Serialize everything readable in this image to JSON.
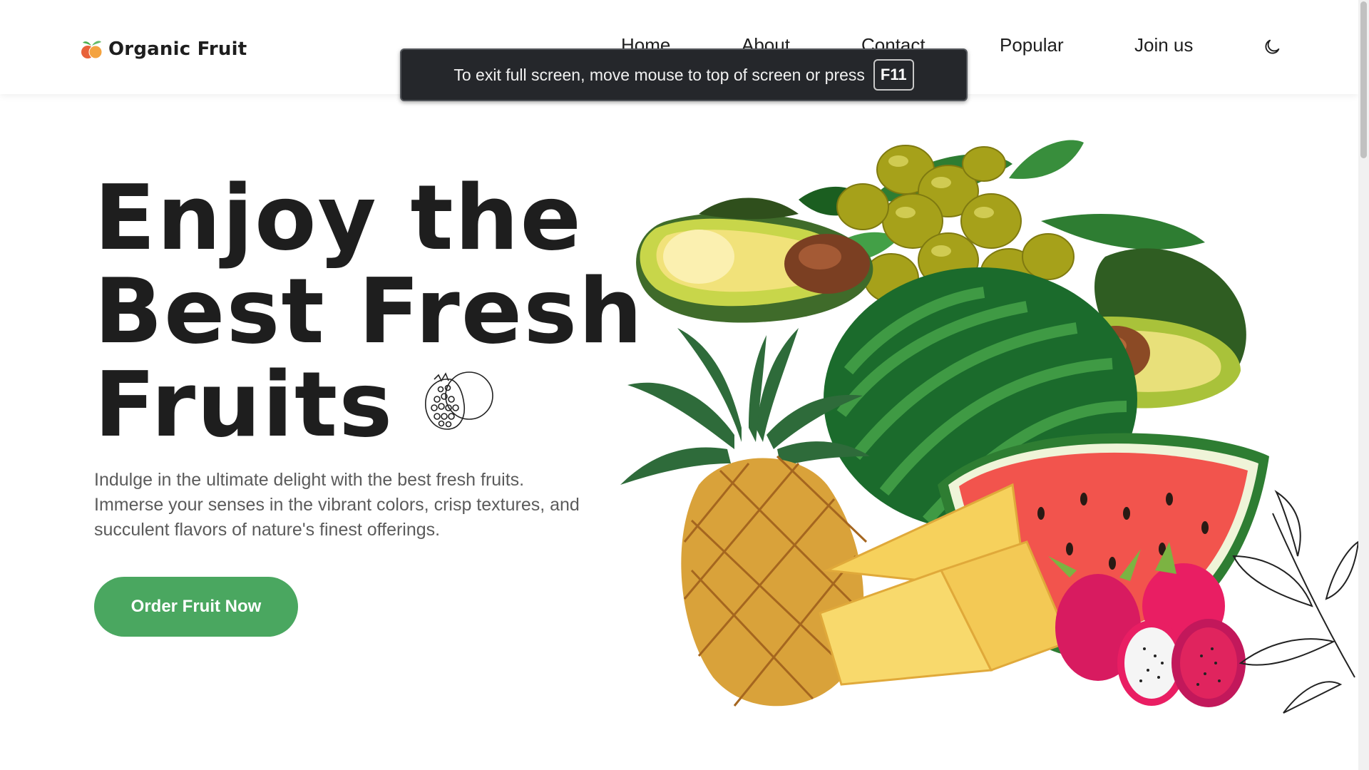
{
  "brand": {
    "name": "Organic Fruit",
    "icon": "fruit-logo-icon"
  },
  "nav": {
    "items": [
      {
        "label": "Home"
      },
      {
        "label": "About"
      },
      {
        "label": "Contact"
      },
      {
        "label": "Popular"
      },
      {
        "label": "Join us"
      }
    ],
    "theme_icon": "moon-icon"
  },
  "fullscreen_notice": {
    "text": "To exit full screen, move mouse to top of screen or press",
    "key": "F11"
  },
  "hero": {
    "title_lines": [
      "Enjoy the",
      "Best Fresh",
      "Fruits"
    ],
    "description": "Indulge in the ultimate delight with the best fresh fruits. Immerse your senses in the vibrant colors, crisp textures, and succulent flavors of nature's finest offerings.",
    "cta_label": "Order Fruit Now"
  },
  "colors": {
    "accent": "#4aa760",
    "text_dark": "#1e1e1e",
    "text_muted": "#5b5b5b",
    "banner_bg": "#25272b"
  }
}
